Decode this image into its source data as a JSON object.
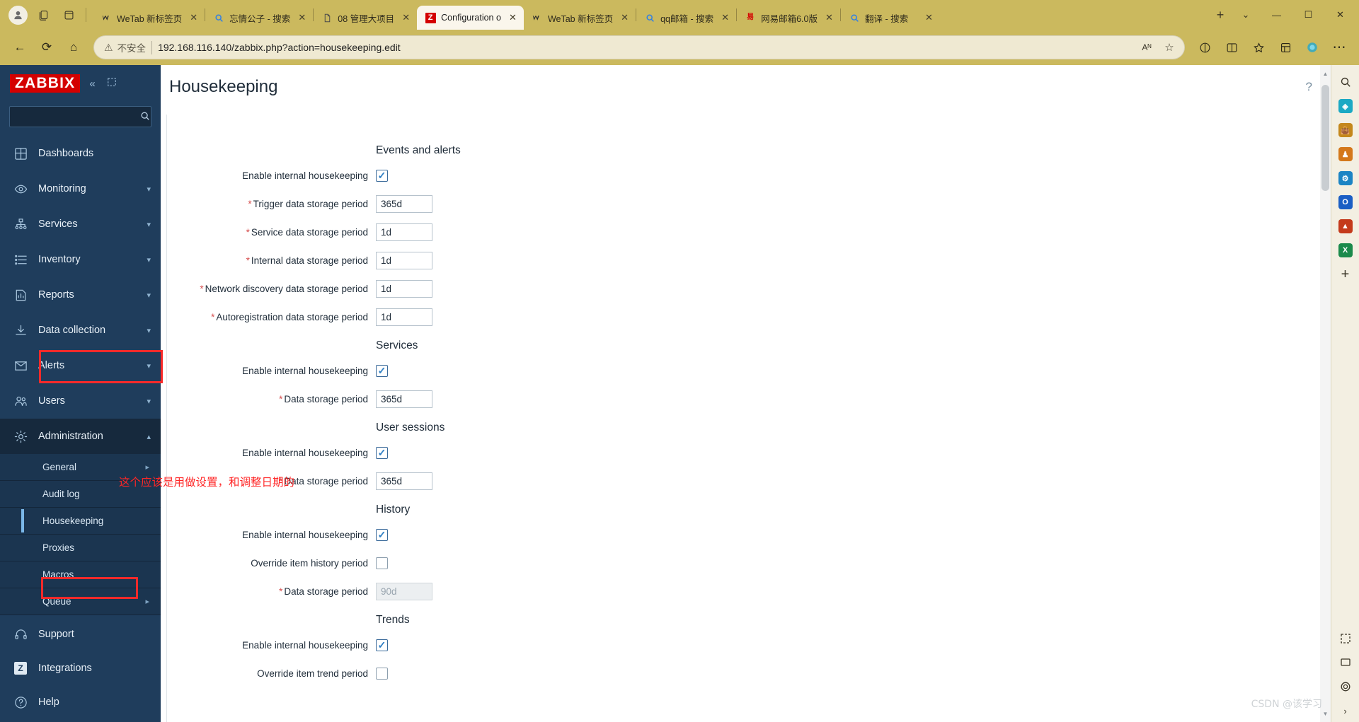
{
  "browser": {
    "left_controls": [
      {
        "name": "profile-avatar",
        "glyph": "●"
      },
      {
        "name": "tab-collections-icon",
        "glyph": "❐"
      },
      {
        "name": "vertical-tabs-icon",
        "glyph": "▢"
      }
    ],
    "tabs": [
      {
        "title": "WeTab 新标签页",
        "favicon": "W",
        "favicon_color": "#2b2b2b",
        "active": false
      },
      {
        "title": "忘情公子 - 搜索",
        "favicon": "search",
        "favicon_color": "#2b7de9",
        "active": false
      },
      {
        "title": "08 管理大项目",
        "favicon": "doc",
        "favicon_color": "#4a4a4a",
        "active": false
      },
      {
        "title": "Configuration o",
        "favicon": "Z",
        "favicon_color": "#d40000",
        "active": true
      },
      {
        "title": "WeTab 新标签页",
        "favicon": "W",
        "favicon_color": "#2b2b2b",
        "active": false
      },
      {
        "title": "qq邮箱 - 搜索",
        "favicon": "search",
        "favicon_color": "#2b7de9",
        "active": false
      },
      {
        "title": "网易邮箱6.0版",
        "favicon": "163",
        "favicon_color": "#d40000",
        "active": false
      },
      {
        "title": "翻译 - 搜索",
        "favicon": "search",
        "favicon_color": "#2b7de9",
        "active": false
      }
    ],
    "new_tab_label": "+",
    "tab_menu_label": "⌄",
    "window_controls": {
      "minimize": "—",
      "maximize": "☐",
      "close": "✕"
    },
    "nav": {
      "back": "←",
      "reload": "⟳",
      "home": "⌂"
    },
    "address": {
      "security_warning": "不安全",
      "warning_icon": "⚠",
      "url": "192.168.116.140/zabbix.php?action=housekeeping.edit",
      "read_aloud_icon": "Aᴺ",
      "favorite_icon": "☆"
    },
    "toolbar_icons": [
      {
        "name": "split-screen-icon",
        "glyph": "◫"
      },
      {
        "name": "browser-essentials-icon",
        "glyph": "◈"
      },
      {
        "name": "favorites-icon",
        "glyph": "☆"
      },
      {
        "name": "collections-icon",
        "glyph": "⊞"
      },
      {
        "name": "copilot-icon",
        "glyph": "◔"
      },
      {
        "name": "settings-more-icon",
        "glyph": "⋯"
      }
    ]
  },
  "zabbix": {
    "logo": "ZABBIX",
    "collapse_icon": "«",
    "hide_icon": "⬚",
    "search": {
      "value": "",
      "placeholder": "",
      "icon": "⌕"
    },
    "nav_items": [
      {
        "label": "Dashboards",
        "icon": "grid-icon",
        "has_chevron": false
      },
      {
        "label": "Monitoring",
        "icon": "eye-icon",
        "has_chevron": true
      },
      {
        "label": "Services",
        "icon": "sitemap-icon",
        "has_chevron": true
      },
      {
        "label": "Inventory",
        "icon": "list-icon",
        "has_chevron": true
      },
      {
        "label": "Reports",
        "icon": "chart-icon",
        "has_chevron": true
      },
      {
        "label": "Data collection",
        "icon": "download-icon",
        "has_chevron": true
      },
      {
        "label": "Alerts",
        "icon": "envelope-icon",
        "has_chevron": true
      },
      {
        "label": "Users",
        "icon": "users-icon",
        "has_chevron": true
      }
    ],
    "administration": {
      "label": "Administration",
      "icon": "gear-icon",
      "chevron": "⌃",
      "expanded": true,
      "subitems": [
        {
          "label": "General",
          "has_chevron": true,
          "selected": false
        },
        {
          "label": "Audit log",
          "has_chevron": false,
          "selected": false
        },
        {
          "label": "Housekeeping",
          "has_chevron": false,
          "selected": true
        },
        {
          "label": "Proxies",
          "has_chevron": false,
          "selected": false
        },
        {
          "label": "Macros",
          "has_chevron": false,
          "selected": false
        },
        {
          "label": "Queue",
          "has_chevron": true,
          "selected": false
        }
      ]
    },
    "footer_items": [
      {
        "label": "Support",
        "icon": "headset-icon"
      },
      {
        "label": "Integrations",
        "icon": "zabbix-z-icon"
      },
      {
        "label": "Help",
        "icon": "question-icon"
      }
    ],
    "page_title": "Housekeeping",
    "help_icon": "?",
    "sections": [
      {
        "title": "Events and alerts",
        "rows": [
          {
            "label": "Enable internal housekeeping",
            "required": false,
            "type": "checkbox",
            "checked": true
          },
          {
            "label": "Trigger data storage period",
            "required": true,
            "type": "text",
            "value": "365d",
            "disabled": false
          },
          {
            "label": "Service data storage period",
            "required": true,
            "type": "text",
            "value": "1d",
            "disabled": false
          },
          {
            "label": "Internal data storage period",
            "required": true,
            "type": "text",
            "value": "1d",
            "disabled": false
          },
          {
            "label": "Network discovery data storage period",
            "required": true,
            "type": "text",
            "value": "1d",
            "disabled": false
          },
          {
            "label": "Autoregistration data storage period",
            "required": true,
            "type": "text",
            "value": "1d",
            "disabled": false
          }
        ]
      },
      {
        "title": "Services",
        "rows": [
          {
            "label": "Enable internal housekeeping",
            "required": false,
            "type": "checkbox",
            "checked": true
          },
          {
            "label": "Data storage period",
            "required": true,
            "type": "text",
            "value": "365d",
            "disabled": false
          }
        ]
      },
      {
        "title": "User sessions",
        "rows": [
          {
            "label": "Enable internal housekeeping",
            "required": false,
            "type": "checkbox",
            "checked": true
          },
          {
            "label": "Data storage period",
            "required": true,
            "type": "text",
            "value": "365d",
            "disabled": false
          }
        ]
      },
      {
        "title": "History",
        "rows": [
          {
            "label": "Enable internal housekeeping",
            "required": false,
            "type": "checkbox",
            "checked": true
          },
          {
            "label": "Override item history period",
            "required": false,
            "type": "checkbox",
            "checked": false
          },
          {
            "label": "Data storage period",
            "required": true,
            "type": "text",
            "value": "90d",
            "disabled": true
          }
        ]
      },
      {
        "title": "Trends",
        "rows": [
          {
            "label": "Enable internal housekeeping",
            "required": false,
            "type": "checkbox",
            "checked": true
          },
          {
            "label": "Override item trend period",
            "required": false,
            "type": "checkbox",
            "checked": false
          }
        ]
      }
    ]
  },
  "annotations": {
    "chinese_note": "这个应该是用做设置，和调整日期的",
    "highlight_color": "#fa2a2a"
  },
  "watermark": "CSDN @该学习"
}
